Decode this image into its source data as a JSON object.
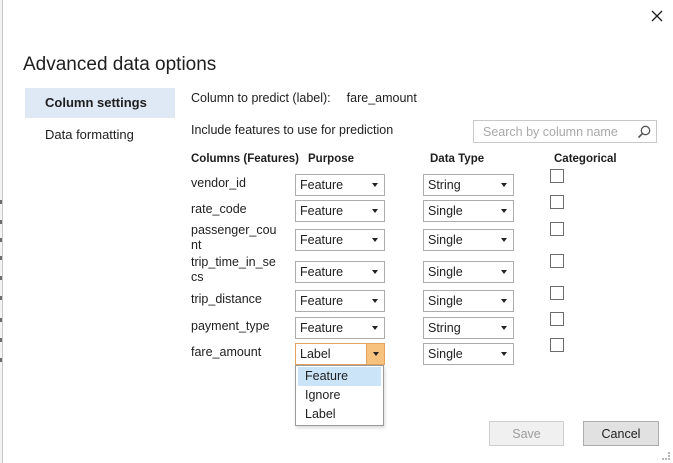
{
  "dialog": {
    "title": "Advanced data options"
  },
  "nav": [
    {
      "label": "Column settings",
      "active": true
    },
    {
      "label": "Data formatting",
      "active": false
    }
  ],
  "predict": {
    "label": "Column to predict (label):",
    "value": "fare_amount"
  },
  "include_label": "Include features to use for prediction",
  "search": {
    "placeholder": "Search by column name",
    "value": ""
  },
  "headers": {
    "columns": "Columns (Features)",
    "purpose": "Purpose",
    "data_type": "Data Type",
    "categorical": "Categorical"
  },
  "rows": [
    {
      "name": "vendor_id",
      "purpose": "Feature",
      "data_type": "String",
      "categorical": false
    },
    {
      "name": "rate_code",
      "purpose": "Feature",
      "data_type": "Single",
      "categorical": false
    },
    {
      "name": "passenger_count",
      "purpose": "Feature",
      "data_type": "Single",
      "categorical": false
    },
    {
      "name": "trip_time_in_secs",
      "purpose": "Feature",
      "data_type": "Single",
      "categorical": false
    },
    {
      "name": "trip_distance",
      "purpose": "Feature",
      "data_type": "Single",
      "categorical": false
    },
    {
      "name": "payment_type",
      "purpose": "Feature",
      "data_type": "String",
      "categorical": false
    },
    {
      "name": "fare_amount",
      "purpose": "Label",
      "data_type": "Single",
      "categorical": false
    }
  ],
  "purpose_dropdown": {
    "options": [
      "Feature",
      "Ignore",
      "Label"
    ],
    "highlighted": "Feature"
  },
  "buttons": {
    "save": "Save",
    "cancel": "Cancel"
  },
  "icons": {
    "close": "close-icon",
    "search": "search-icon",
    "dropdown": "chevron-down-icon"
  },
  "colors": {
    "nav_active_bg": "#dfe8f5",
    "open_select_accent": "#f7c27e",
    "dropdown_highlight": "#cce4f7"
  }
}
